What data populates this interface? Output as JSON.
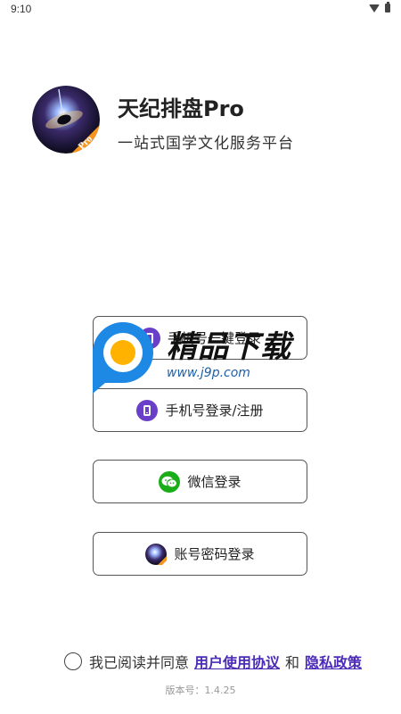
{
  "status_bar": {
    "time": "9:10"
  },
  "app": {
    "name": "天纪排盘Pro",
    "slogan": "一站式国学文化服务平台",
    "logo_badge": "Pro"
  },
  "buttons": {
    "phone_login_1": "手机号一键登录",
    "phone_login_2": "手机号登录/注册",
    "wechat_login": "微信登录",
    "account_login": "账号密码登录"
  },
  "watermark": {
    "text": "精品下载",
    "url": "www.j9p.com"
  },
  "agreement": {
    "prefix": "我已阅读并同意",
    "user_agreement": "用户使用协议",
    "conjunction": "和",
    "privacy_policy": "隐私政策"
  },
  "version": "版本号：1.4.25",
  "colors": {
    "accent": "#6a3fc8",
    "wechat": "#1aad19",
    "link": "#4b2bb8",
    "logo_badge": "#f7941d",
    "watermark_blue": "#1e88e5",
    "watermark_orange": "#ffb300"
  },
  "icons": [
    "wifi-icon",
    "battery-icon",
    "phone-icon",
    "wechat-icon",
    "app-logo-icon"
  ]
}
